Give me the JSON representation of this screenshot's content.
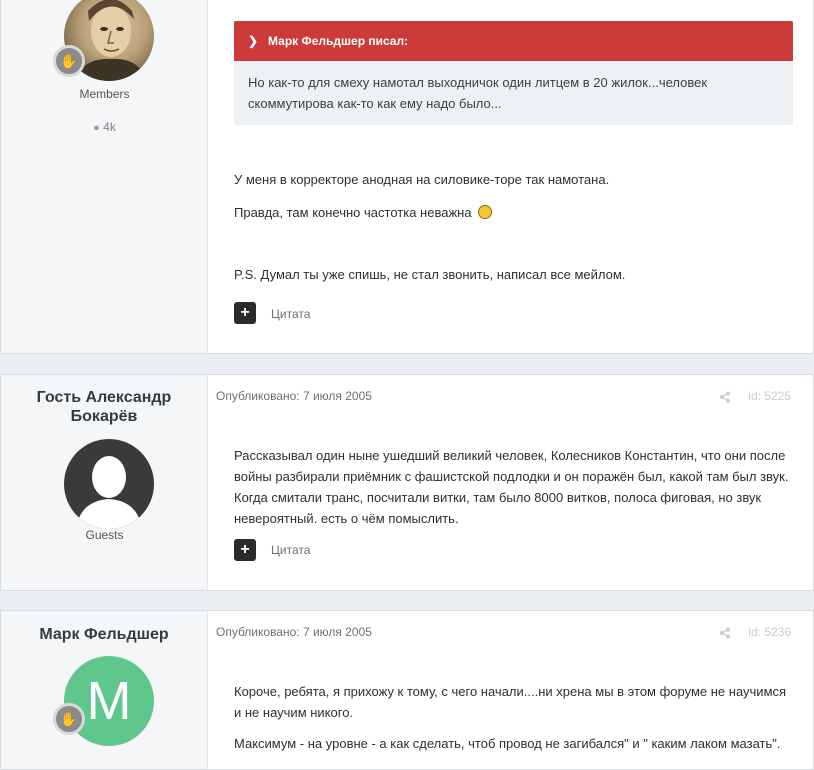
{
  "post1": {
    "group": "Members",
    "posts_count": "4k",
    "quote": {
      "author_line": "Марк Фельдшер писал:",
      "text": "Но как-то для смеху намотал выходничок один литцем в 20 жилок...человек скоммутирова как-то как ему надо было..."
    },
    "paragraphs": [
      "У меня в корректоре анодная на силовике-торе так намотана.",
      "Правда, там конечно частотка неважна",
      "P.S. Думал ты уже спишь, не стал звонить, написал все мейлом."
    ],
    "quote_label": "Цитата"
  },
  "post2": {
    "author": "Гость Александр Бокарёв",
    "group": "Guests",
    "published": "Опубликовано: 7 июля 2005",
    "id": "id: 5225",
    "text": "Рассказывал один ныне ушедший великий человек, Колесников Константин, что они после войны разбирали приёмник с фашистской подлодки и он поражён был, какой там был звук. Когда смитали транс, посчитали витки, там было 8000 витков, полоса фиговая, но звук невероятный. есть о чём помыслить.",
    "quote_label": "Цитата"
  },
  "post3": {
    "author": "Марк Фельдшер",
    "avatar_letter": "M",
    "published": "Опубликовано: 7 июля 2005",
    "id": "id: 5236",
    "paragraphs": [
      "Короче, ребята, я прихожу к тому, с чего начали....ни хрена мы в этом форуме не научимся и не научим никого.",
      "Максимум - на уровне - а как сделать, чтоб провод не загибался\" и \" каким лаком мазать\"."
    ]
  },
  "colors": {
    "quote_header": "#cc3a3a",
    "avatar_green": "#5fc78c",
    "dark_button": "#2b2b2b"
  }
}
